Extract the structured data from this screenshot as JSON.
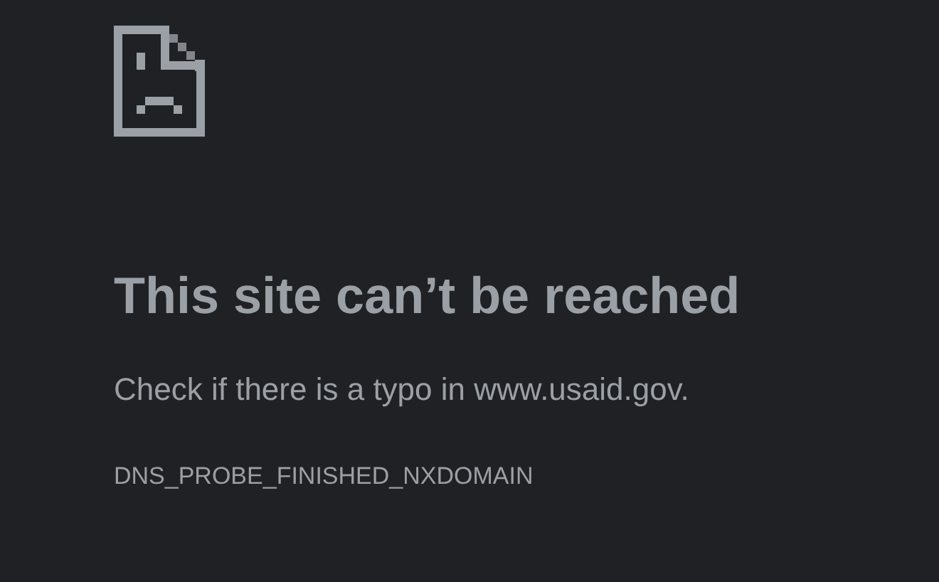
{
  "error_page": {
    "heading": "This site can’t be reached",
    "message": "Check if there is a typo in www.usaid.gov.",
    "error_code": "DNS_PROBE_FINISHED_NXDOMAIN"
  }
}
